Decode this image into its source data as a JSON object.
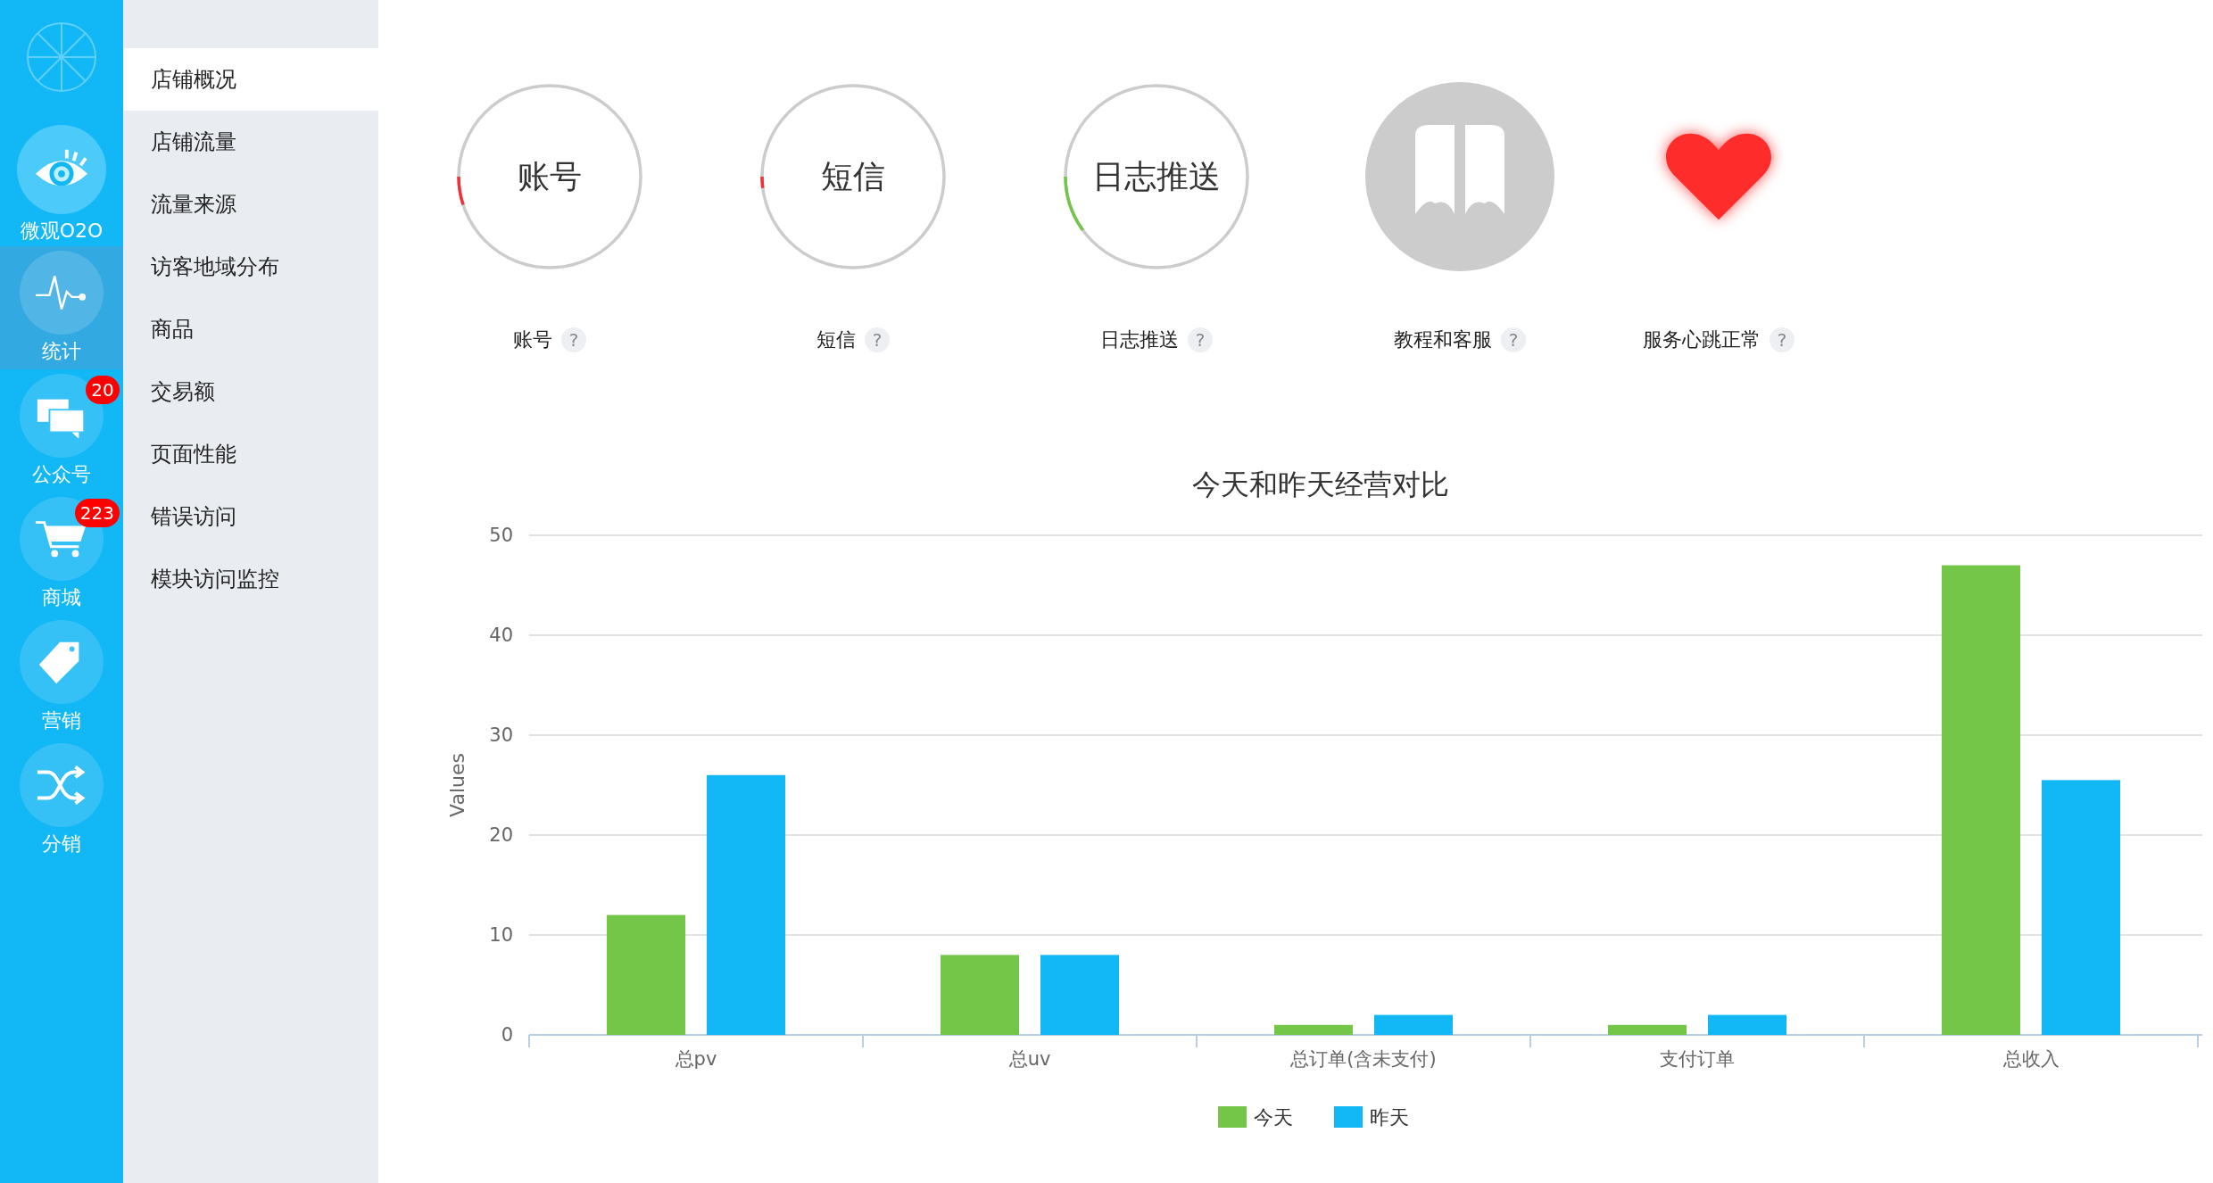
{
  "nav": [
    {
      "label": "微观O2O",
      "selected": false
    },
    {
      "label": "统计",
      "selected": true
    },
    {
      "label": "公众号",
      "badge": "20",
      "selected": false
    },
    {
      "label": "商城",
      "badge": "223",
      "selected": false
    },
    {
      "label": "营销",
      "selected": false
    },
    {
      "label": "分销",
      "selected": false
    }
  ],
  "menu": [
    {
      "label": "店铺概况",
      "selected": true
    },
    {
      "label": "店铺流量",
      "selected": false
    },
    {
      "label": "流量来源",
      "selected": false
    },
    {
      "label": "访客地域分布",
      "selected": false
    },
    {
      "label": "商品",
      "selected": false
    },
    {
      "label": "交易额",
      "selected": false
    },
    {
      "label": "页面性能",
      "selected": false
    },
    {
      "label": "错误访问",
      "selected": false
    },
    {
      "label": "模块访问监控",
      "selected": false
    }
  ],
  "status": [
    {
      "kind": "ring",
      "text": "账号",
      "level": 0.05,
      "color": "#f0303a",
      "label": "账号",
      "help": "?"
    },
    {
      "kind": "ring",
      "text": "短信",
      "level": 0.02,
      "color": "#f0303a",
      "label": "短信",
      "help": "?"
    },
    {
      "kind": "ring",
      "text": "日志推送",
      "level": 0.1,
      "color": "#74c44a",
      "label": "日志推送",
      "help": "?"
    },
    {
      "kind": "book",
      "label": "教程和客服",
      "help": "?"
    },
    {
      "kind": "heart",
      "label": "服务心跳正常",
      "help": "?"
    }
  ],
  "chart": {
    "chart_data": {
      "type": "bar",
      "title": "今天和昨天经营对比",
      "ylabel": "Values",
      "categories": [
        "总pv",
        "总uv",
        "总订单(含未支付)",
        "支付订单",
        "总收入"
      ],
      "ylim": [
        0,
        50
      ],
      "yticks": [
        0,
        10,
        20,
        30,
        40,
        50
      ],
      "grid": true,
      "legend": "bottom",
      "series": [
        {
          "name": "今天",
          "color": "#74c648",
          "values": [
            12,
            8,
            1,
            1,
            47
          ]
        },
        {
          "name": "昨天",
          "color": "#12b7f5",
          "values": [
            26,
            8,
            2,
            2,
            25.5
          ]
        }
      ]
    }
  }
}
